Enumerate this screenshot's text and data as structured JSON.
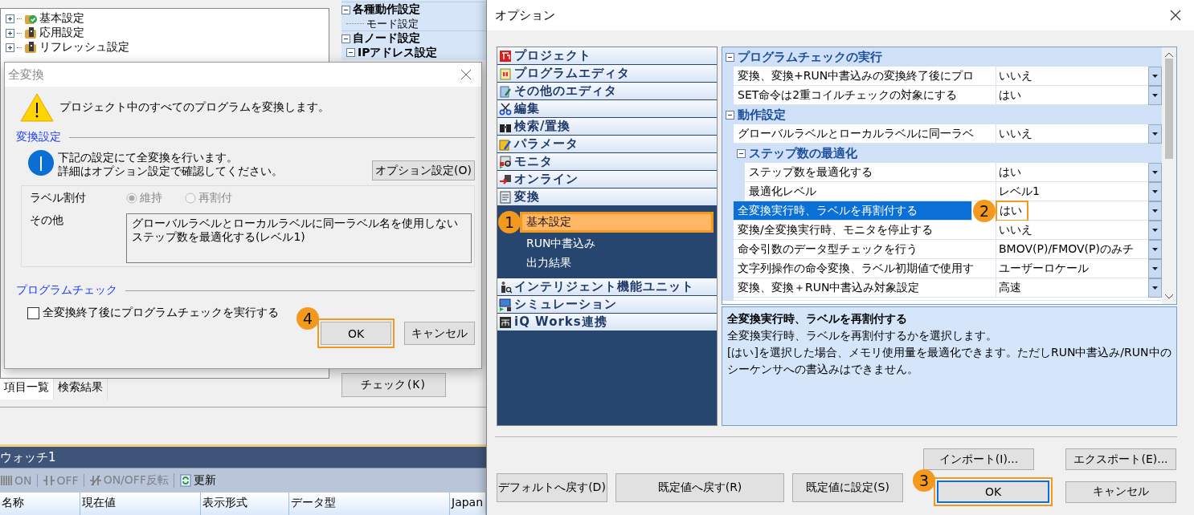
{
  "background_app": {
    "project_tree": [
      {
        "label": "基本設定",
        "kind": "done"
      },
      {
        "label": "応用設定",
        "kind": "pending"
      },
      {
        "label": "リフレッシュ設定",
        "kind": "pending"
      }
    ],
    "parameter_tree": [
      {
        "label": "各種動作設定",
        "expanded": true,
        "children": [
          {
            "label": "モード設定"
          }
        ]
      },
      {
        "label": "自ノード設定",
        "expanded": true,
        "children": [
          {
            "label": "IPアドレス設定",
            "expanded": true
          }
        ]
      }
    ],
    "check_button": "チェック(K)",
    "tabs": [
      {
        "label": "項目一覧",
        "selected": true
      },
      {
        "label": "検索結果",
        "selected": false
      }
    ],
    "watch": {
      "title": "ウォッチ1",
      "toolbar": [
        {
          "label": "ON",
          "kind": "on",
          "disabled": true
        },
        {
          "label": "OFF",
          "kind": "off",
          "disabled": true
        },
        {
          "label": "ON/OFF反転",
          "kind": "toggle",
          "disabled": true
        },
        {
          "label": "更新",
          "kind": "refresh",
          "disabled": false
        }
      ],
      "columns": [
        "名称",
        "現在値",
        "表示形式",
        "データ型",
        "Japan"
      ]
    }
  },
  "convert_all_dialog": {
    "title": "全変換",
    "message": "プロジェクト中のすべてのプログラムを変換します。",
    "section_convert": "変換設定",
    "info": [
      "下記の設定にて全変換を行います。",
      "詳細はオプション設定で確認してください。"
    ],
    "option_button": "オプション設定(O)",
    "label_assign": {
      "label": "ラベル割付",
      "disabled": true,
      "options": [
        {
          "label": "維持",
          "selected": true
        },
        {
          "label": "再割付",
          "selected": false
        }
      ]
    },
    "other": {
      "label": "その他",
      "lines": [
        "グローバルラベルとローカルラベルに同一ラベル名を使用しない",
        "ステップ数を最適化する(レベル1)"
      ]
    },
    "section_check": "プログラムチェック",
    "run_check": {
      "label": "全変換終了後にプログラムチェックを実行する",
      "checked": false
    },
    "buttons": [
      {
        "label": "OK",
        "callout": "4"
      },
      {
        "label": "キャンセル"
      }
    ]
  },
  "options_dialog": {
    "title": "オプション",
    "categories": [
      {
        "label": "プロジェクト",
        "kind": "project"
      },
      {
        "label": "プログラムエディタ",
        "kind": "editor"
      },
      {
        "label": "その他のエディタ",
        "kind": "other_editor"
      },
      {
        "label": "編集",
        "kind": "edit"
      },
      {
        "label": "検索/置換",
        "kind": "search"
      },
      {
        "label": "パラメータ",
        "kind": "parameter"
      },
      {
        "label": "モニタ",
        "kind": "monitor"
      },
      {
        "label": "オンライン",
        "kind": "online"
      },
      {
        "label": "変換",
        "kind": "convert",
        "children": [
          {
            "label": "基本設定",
            "selected": true,
            "callout": "1"
          },
          {
            "label": "RUN中書込み",
            "selected": false
          },
          {
            "label": "出力結果",
            "selected": false
          }
        ]
      },
      {
        "label": "インテリジェント機能ユニット",
        "kind": "module"
      },
      {
        "label": "シミュレーション",
        "kind": "simulation"
      },
      {
        "label": "iQ Works連携",
        "kind": "works"
      }
    ],
    "properties": [
      {
        "kind": "group",
        "label": "プログラムチェックの実行",
        "expanded": true,
        "children": [
          {
            "kind": "item",
            "name": "変換、変換+RUN中書込みの変換終了後にプロ",
            "value": "いいえ",
            "selected": false
          },
          {
            "kind": "item",
            "name": "SET命令は2重コイルチェックの対象にする",
            "value": "はい",
            "selected": false
          }
        ]
      },
      {
        "kind": "group",
        "label": "動作設定",
        "expanded": true,
        "children": [
          {
            "kind": "item",
            "name": "グローバルラベルとローカルラベルに同一ラベ",
            "value": "いいえ",
            "selected": false
          },
          {
            "kind": "group",
            "label": "ステップ数の最適化",
            "expanded": true,
            "children": [
              {
                "kind": "item",
                "name": "ステップ数を最適化する",
                "value": "はい",
                "selected": false
              },
              {
                "kind": "item",
                "name": "最適化レベル",
                "value": "レベル1",
                "selected": false
              }
            ]
          },
          {
            "kind": "item",
            "name": "全変換実行時、ラベルを再割付する",
            "value": "はい",
            "selected": true,
            "callout": "2"
          },
          {
            "kind": "item",
            "name": "変換/全変換実行時、モニタを停止する",
            "value": "いいえ",
            "selected": false
          },
          {
            "kind": "item",
            "name": "命令引数のデータ型チェックを行う",
            "value": "BMOV(P)/FMOV(P)のみチ",
            "selected": false
          },
          {
            "kind": "item",
            "name": "文字列操作の命令変換、ラベル初期値で使用す",
            "value": "ユーザーロケール",
            "selected": false
          },
          {
            "kind": "item",
            "name": "変換、変換＋RUN中書込み対象設定",
            "value": "高速",
            "selected": false
          }
        ]
      }
    ],
    "description": {
      "title": "全変換実行時、ラベルを再割付する",
      "lines": [
        "全変換実行時、ラベルを再割付するかを選択します。",
        "[はい]を選択した場合、メモリ使用量を最適化できます。ただしRUN中書込み/RUN中のシーケンサへの書込みはできません。"
      ]
    },
    "secondary_buttons": [
      "インポート(I)...",
      "エクスポート(E)..."
    ],
    "buttons": [
      {
        "label": "デフォルトへ戻す(D)",
        "kind": "reset"
      },
      {
        "label": "既定値へ戻す(R)",
        "kind": "reset"
      },
      {
        "label": "既定値に設定(S)",
        "kind": "reset"
      },
      {
        "label": "OK",
        "kind": "default",
        "callout": "3"
      },
      {
        "label": "キャンセル",
        "kind": "normal"
      }
    ]
  }
}
